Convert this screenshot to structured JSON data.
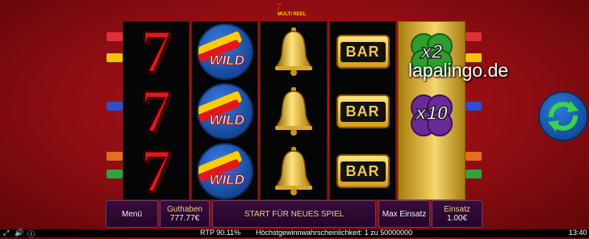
{
  "logo": {
    "text": "MULTI REEL"
  },
  "watermark": {
    "text": "lapalingo.de"
  },
  "reels": [
    [
      "seven-symbol",
      "seven-symbol",
      "seven-symbol"
    ],
    [
      "wild-symbol",
      "wild-symbol",
      "wild-symbol"
    ],
    [
      "bell-symbol",
      "bell-symbol",
      "bell-symbol"
    ],
    [
      "bar-symbol",
      "bar-symbol",
      "bar-symbol"
    ]
  ],
  "symbol_text": {
    "seven": "7",
    "wild": "WILD",
    "bar": "BAR"
  },
  "multipliers": [
    {
      "label": "x2",
      "color": "#2e9e2e"
    },
    {
      "label": "x10",
      "color": "#6a2a9a"
    }
  ],
  "payline_colors": [
    "#e0313a",
    "#f2c30b",
    "#2b4fd0",
    "#e56d1f",
    "#2aa63c"
  ],
  "buttons": {
    "menu": "Menü",
    "balance_label": "Guthaben",
    "balance_value": "777.77€",
    "spin": "START FÜR NEUES SPIEL",
    "max_bet": "Max Einsatz",
    "bet_label": "Einsatz",
    "bet_value": "1.00€"
  },
  "status": {
    "rtp": "RTP 90.11%",
    "win_chance": "Höchstgewinnwahrscheinlichkeit: 1 zu 50000000",
    "time": "13:40"
  },
  "colors": {
    "accent_gold": "#e9d27a",
    "button_bg": "#2a0830"
  }
}
